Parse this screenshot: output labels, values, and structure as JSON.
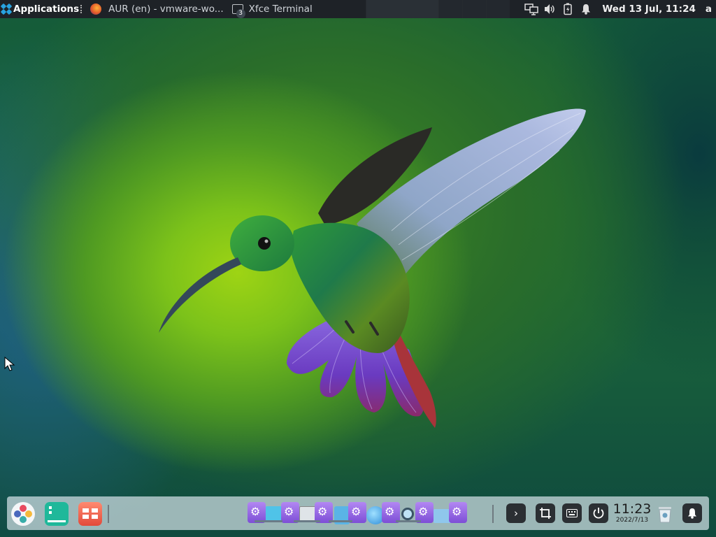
{
  "top_panel": {
    "applications_label": "Applications",
    "tasks": [
      {
        "label": "AUR (en) - vmware-wo...",
        "icon": "firefox-icon"
      },
      {
        "label": "Xfce Terminal",
        "icon": "terminal-icon",
        "badge": "3"
      }
    ],
    "tray_icons": [
      "network-icon",
      "volume-icon",
      "battery-icon",
      "notification-bell-icon"
    ],
    "clock": "Wed 13 Jul, 11:24",
    "user": "a"
  },
  "dock": {
    "clock_time": "11:23",
    "clock_date": "2022/7/13"
  },
  "colors": {
    "panel_bg": "#1e2227",
    "dock_bg": "#d2e1e6",
    "accent": "#28a3e0"
  }
}
